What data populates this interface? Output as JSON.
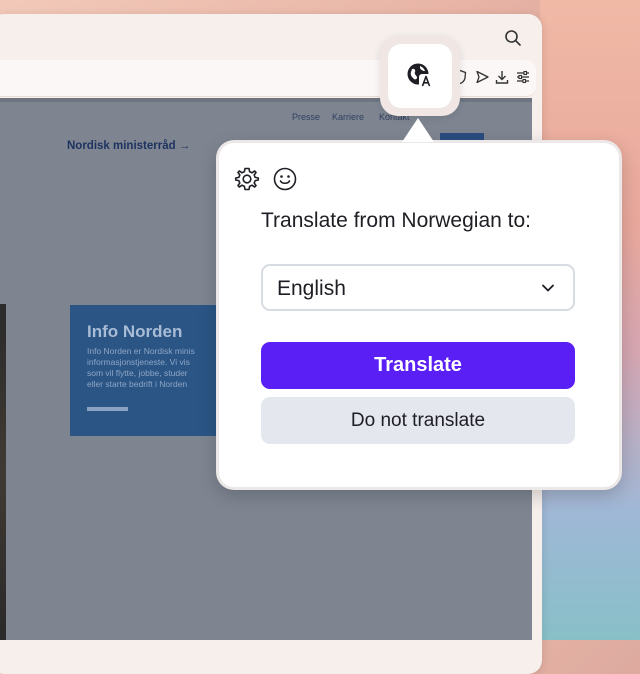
{
  "website": {
    "nav_links": [
      "Presse",
      "Karriere",
      "Kontakt"
    ],
    "nordisk_link": "Nordisk ministerråd →",
    "info_card": {
      "title": "Info Norden",
      "lines": [
        "Info Norden er Nordisk minis",
        "informasjonstjeneste. Vi vis",
        "som vil flytte, jobbe, studer",
        "eller starte bedrift i Norden"
      ]
    }
  },
  "toolbar": {
    "icons": [
      "search-icon",
      "translate-icon",
      "shield-icon",
      "send-icon",
      "download-icon",
      "settings-sliders-icon"
    ]
  },
  "popup": {
    "prompt": "Translate from Norwegian to:",
    "language_selected": "English",
    "translate_label": "Translate",
    "do_not_translate_label": "Do not translate",
    "icons": [
      "gear-icon",
      "smiley-icon"
    ]
  },
  "colors": {
    "accent": "#5a1ff5",
    "secondary_button": "#e4e7ee",
    "info_card": "#2a5585"
  }
}
